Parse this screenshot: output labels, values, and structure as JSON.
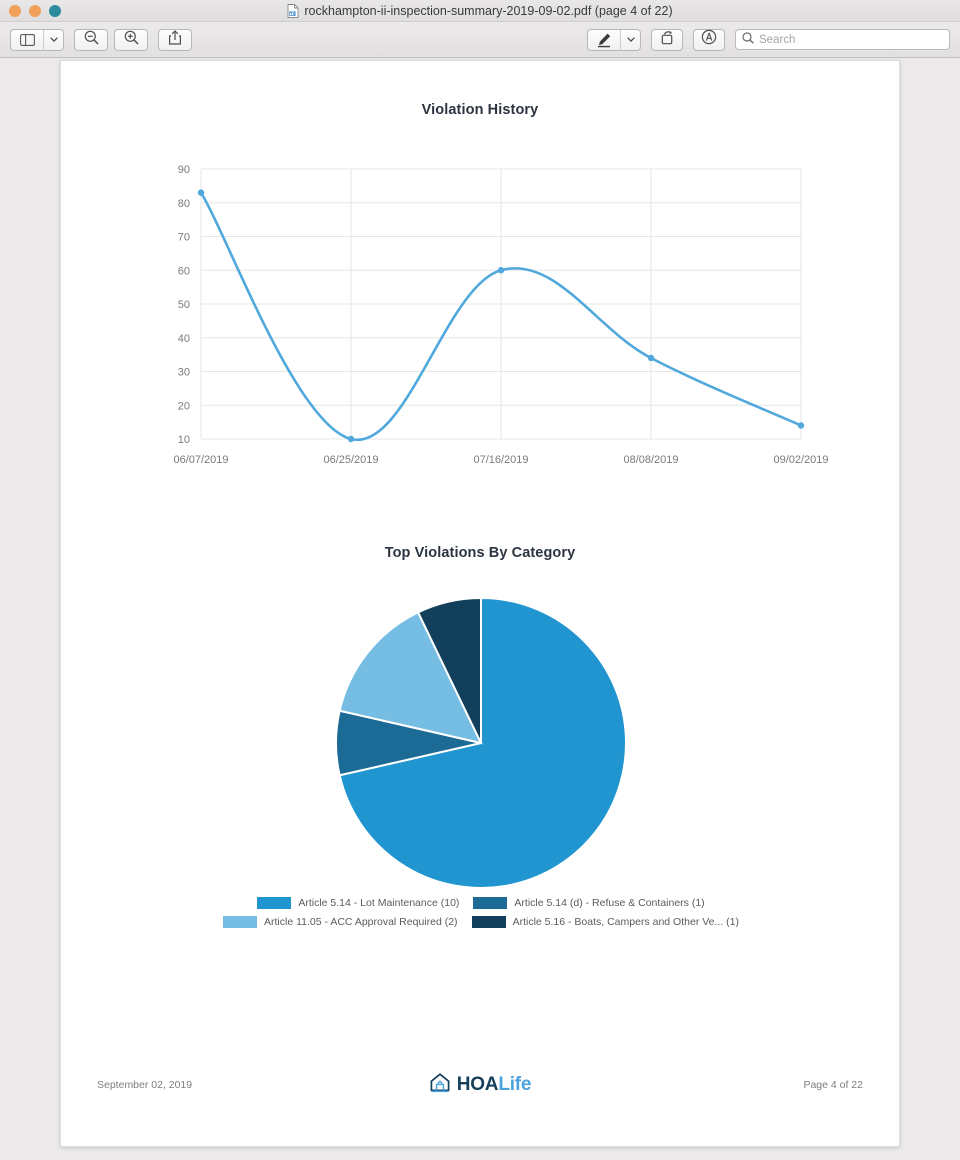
{
  "window": {
    "title": "rockhampton-ii-inspection-summary-2019-09-02.pdf (page 4 of 22)",
    "doc_icon": "pdf-document-icon",
    "traffic_lights": {
      "close": "#f0a059",
      "minimize": "#f0a059",
      "maximize": "#2c8c9b"
    }
  },
  "toolbar": {
    "sidebar_button": {
      "icon": "sidebar-panel-icon",
      "arrow": "chevron-down-icon"
    },
    "zoom_out_button": {
      "icon": "zoom-out-icon",
      "label": "Zoom Out"
    },
    "zoom_in_button": {
      "icon": "zoom-in-icon",
      "label": "Zoom In"
    },
    "share_button": {
      "icon": "share-icon",
      "label": "Share"
    },
    "markup_button": {
      "icon": "markup-pen-icon",
      "arrow": "chevron-down-icon"
    },
    "rotate_button": {
      "icon": "rotate-icon",
      "label": "Rotate"
    },
    "annotate_button": {
      "icon": "annotate-highlight-icon",
      "label": "Highlight"
    },
    "search": {
      "icon": "search-icon",
      "value": "",
      "placeholder": "Search"
    }
  },
  "document": {
    "line_chart_title": "Violation History",
    "pie_chart_title": "Top Violations By Category",
    "footer": {
      "date": "September 02, 2019",
      "page": "Page 4 of 22",
      "logo_icon": "hoalife-house-icon",
      "logo_primary": "HOA",
      "logo_secondary": "Life"
    }
  },
  "chart_data": [
    {
      "type": "line",
      "title": "Violation History",
      "xlabel": "",
      "ylabel": "",
      "x": [
        "06/07/2019",
        "06/25/2019",
        "07/16/2019",
        "08/08/2019",
        "09/02/2019"
      ],
      "values": [
        83,
        10,
        60,
        34,
        14
      ],
      "ylim": [
        10,
        90
      ],
      "yticks": [
        10,
        20,
        30,
        40,
        50,
        60,
        70,
        80,
        90
      ],
      "grid": true,
      "legend": "none",
      "series_color": "#51a8dd",
      "interpolation": "smooth-spline",
      "point_marker": "circle"
    },
    {
      "type": "pie",
      "title": "Top Violations By Category",
      "legend_position": "bottom",
      "start_angle": 0,
      "direction": "clockwise",
      "total": 14,
      "slices": [
        {
          "label": "Article 5.14 - Lot Maintenance (10)",
          "value": 10,
          "color": "#2095d0"
        },
        {
          "label": "Article 5.14 (d) - Refuse & Containers (1)",
          "value": 1,
          "color": "#1c6a96"
        },
        {
          "label": "Article 11.05 - ACC Approval Required (2)",
          "value": 2,
          "color": "#76bde4"
        },
        {
          "label": "Article 5.16 - Boats, Campers and Other Ve... (1)",
          "value": 1,
          "color": "#12405c"
        }
      ]
    }
  ]
}
